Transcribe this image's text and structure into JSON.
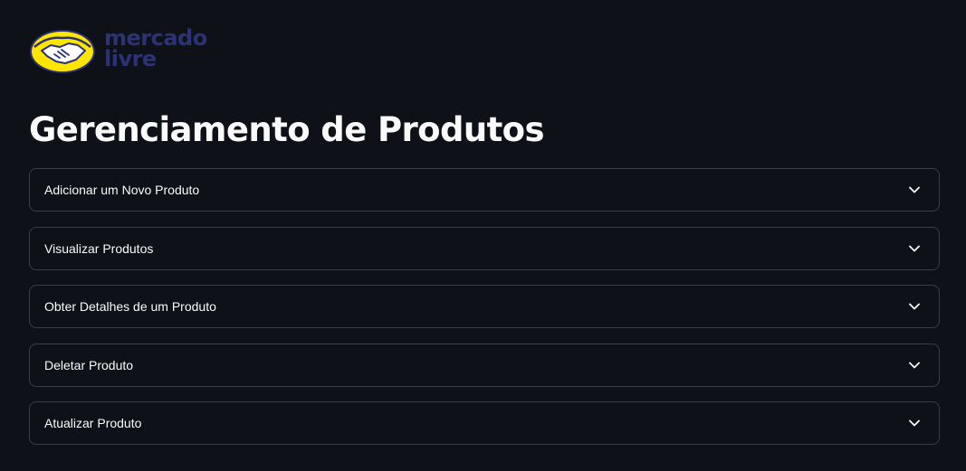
{
  "logo": {
    "line1": "mercado",
    "line2": "livre",
    "brand_yellow": "#ffe600",
    "brand_blue": "#2d3277"
  },
  "page": {
    "title": "Gerenciamento de Produtos"
  },
  "expanders": [
    {
      "label": "Adicionar um Novo Produto",
      "icon": "chevron-down-icon"
    },
    {
      "label": "Visualizar Produtos",
      "icon": "chevron-down-icon"
    },
    {
      "label": "Obter Detalhes de um Produto",
      "icon": "chevron-down-icon"
    },
    {
      "label": "Deletar Produto",
      "icon": "chevron-down-icon"
    },
    {
      "label": "Atualizar Produto",
      "icon": "chevron-down-icon"
    }
  ],
  "theme": {
    "background": "#0e1117",
    "text": "#fafafa",
    "border": "#3a3d47"
  }
}
